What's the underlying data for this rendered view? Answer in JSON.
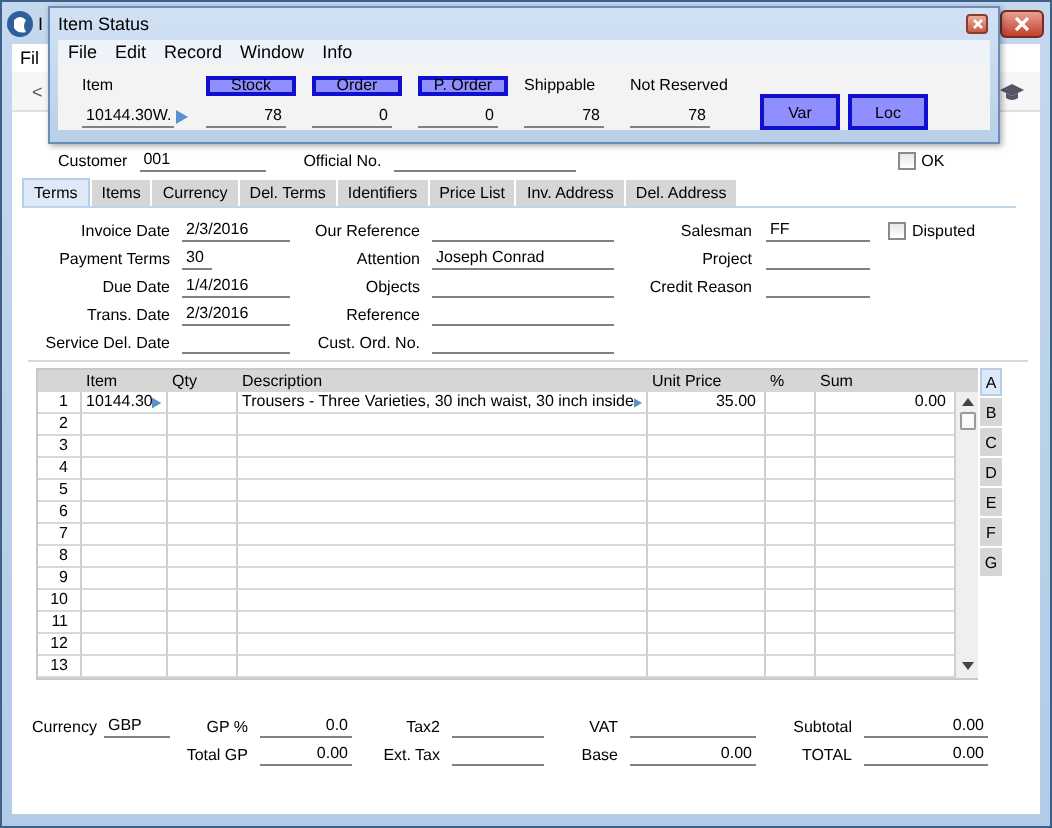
{
  "main_window": {
    "title": "I",
    "menu": [
      "Fil"
    ],
    "toolbar": {
      "back_label": "<"
    }
  },
  "item_status": {
    "title": "Item Status",
    "menu": [
      "File",
      "Edit",
      "Record",
      "Window",
      "Info"
    ],
    "columns": [
      {
        "kind": "item",
        "header": "Item",
        "value": "10144.30W."
      },
      {
        "kind": "button",
        "header": "Stock",
        "value": "78"
      },
      {
        "kind": "button",
        "header": "Order",
        "value": "0"
      },
      {
        "kind": "button",
        "header": "P. Order",
        "value": "0"
      },
      {
        "kind": "label",
        "header": "Shippable",
        "value": "78"
      },
      {
        "kind": "label",
        "header": "Not Reserved",
        "value": "78"
      }
    ],
    "buttons": [
      "Var",
      "Loc"
    ]
  },
  "header": {
    "fields": [
      {
        "label": "Customer",
        "value": "001"
      },
      {
        "label": "Official No."
      }
    ],
    "ok": {
      "label": "OK",
      "checked": false
    }
  },
  "tabs": [
    {
      "label": "Terms",
      "selected": true
    },
    {
      "label": "Items",
      "selected": false
    },
    {
      "label": "Currency",
      "selected": false
    },
    {
      "label": "Del. Terms",
      "selected": false
    },
    {
      "label": "Identifiers",
      "selected": false
    },
    {
      "label": "Price List",
      "selected": false
    },
    {
      "label": "Inv. Address",
      "selected": false
    },
    {
      "label": "Del. Address",
      "selected": false
    }
  ],
  "terms": {
    "columns": [
      [
        {
          "label": "Invoice Date",
          "value": "2/3/2016"
        },
        {
          "label": "Payment Terms",
          "value": "30"
        },
        {
          "label": "Due Date",
          "value": "1/4/2016"
        },
        {
          "label": "Trans. Date",
          "value": "2/3/2016"
        },
        {
          "label": "Service Del. Date"
        }
      ],
      [
        {
          "label": "Our Reference"
        },
        {
          "label": "Attention",
          "value": "Joseph Conrad"
        },
        {
          "label": "Objects"
        },
        {
          "label": "Reference"
        },
        {
          "label": "Cust. Ord. No."
        }
      ],
      [
        {
          "label": "Salesman",
          "value": "FF"
        },
        {
          "label": "Project"
        },
        {
          "label": "Credit Reason"
        }
      ]
    ],
    "disputed": {
      "label": "Disputed",
      "checked": false
    }
  },
  "table": {
    "columns": [
      "Item",
      "Qty",
      "Description",
      "Unit Price",
      "%",
      "Sum"
    ],
    "rows": [
      {
        "number": "1",
        "item": "10144.30",
        "description": "Trousers - Three Varieties, 30 inch waist, 30 inch inside",
        "unit_price": "35.00",
        "sum": "0.00"
      },
      {
        "number": "2"
      },
      {
        "number": "3"
      },
      {
        "number": "4"
      },
      {
        "number": "5"
      },
      {
        "number": "6"
      },
      {
        "number": "7"
      },
      {
        "number": "8"
      },
      {
        "number": "9"
      },
      {
        "number": "10"
      },
      {
        "number": "11"
      },
      {
        "number": "12"
      },
      {
        "number": "13"
      }
    ]
  },
  "side_tabs": [
    {
      "label": "A",
      "selected": true
    },
    {
      "label": "B",
      "selected": false
    },
    {
      "label": "C",
      "selected": false
    },
    {
      "label": "D",
      "selected": false
    },
    {
      "label": "E",
      "selected": false
    },
    {
      "label": "F",
      "selected": false
    },
    {
      "label": "G",
      "selected": false
    }
  ],
  "totals": {
    "rows": [
      [
        {
          "label": "Currency",
          "value": "GBP"
        },
        {
          "label": "GP %",
          "value": "0.0"
        },
        {
          "label": "Tax2"
        },
        {
          "label": "VAT"
        },
        {
          "label": "Subtotal",
          "value": "0.00"
        }
      ],
      [
        null,
        {
          "label": "Total GP",
          "value": "0.00"
        },
        {
          "label": "Ext. Tax"
        },
        {
          "label": "Base",
          "value": "0.00"
        },
        {
          "label": "TOTAL",
          "value": "0.00"
        }
      ]
    ]
  }
}
